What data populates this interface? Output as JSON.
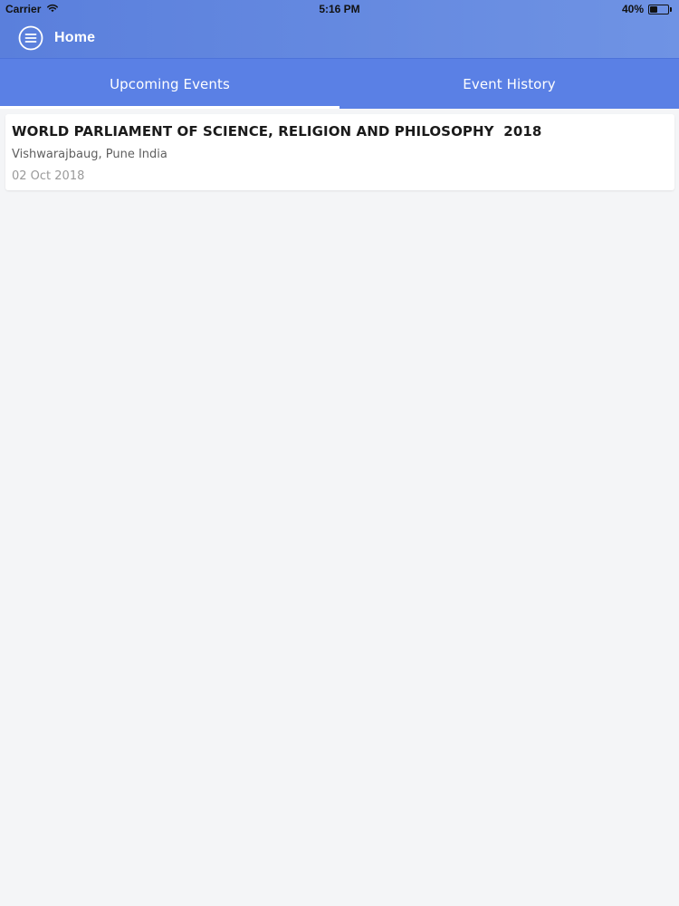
{
  "status_bar": {
    "carrier": "Carrier",
    "time": "5:16 PM",
    "battery_text": "40%",
    "battery_level": 0.4,
    "wifi_icon": "wifi-icon",
    "battery_icon": "battery-icon"
  },
  "header": {
    "title": "Home",
    "menu_icon": "menu-icon"
  },
  "tabs": [
    {
      "label": "Upcoming Events",
      "selected": true
    },
    {
      "label": "Event History",
      "selected": false
    }
  ],
  "events": [
    {
      "title": "WORLD PARLIAMENT OF SCIENCE, RELIGION AND PHILOSOPHY  2018",
      "location": "Vishwarajbaug, Pune India",
      "date": "02 Oct 2018"
    }
  ],
  "colors": {
    "header_bg_start": "#5a7fdc",
    "header_bg_end": "#6f93e4",
    "tab_bar_bg": "#5a80e5",
    "page_bg": "#f4f5f7"
  }
}
